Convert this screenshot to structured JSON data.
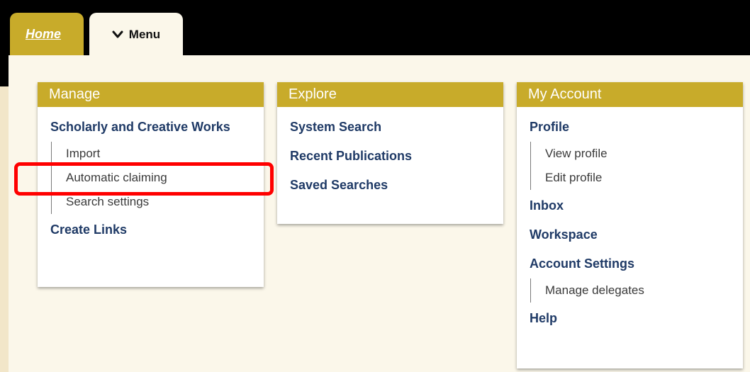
{
  "tabs": {
    "home_label": "Home",
    "menu_label": "Menu"
  },
  "manage": {
    "title": "Manage",
    "scholarly_label": "Scholarly and Creative Works",
    "scholarly_items": [
      "Import",
      "Automatic claiming",
      "Search settings"
    ],
    "create_links_label": "Create Links"
  },
  "explore": {
    "title": "Explore",
    "items": [
      "System Search",
      "Recent Publications",
      "Saved Searches"
    ]
  },
  "account": {
    "title": "My Account",
    "profile_label": "Profile",
    "profile_items": [
      "View profile",
      "Edit profile"
    ],
    "inbox_label": "Inbox",
    "workspace_label": "Workspace",
    "settings_label": "Account Settings",
    "settings_items": [
      "Manage delegates"
    ],
    "help_label": "Help"
  },
  "colors": {
    "accent_gold": "#c8ab2a",
    "link_navy": "#1f3a66",
    "highlight_red": "#ff0000"
  }
}
